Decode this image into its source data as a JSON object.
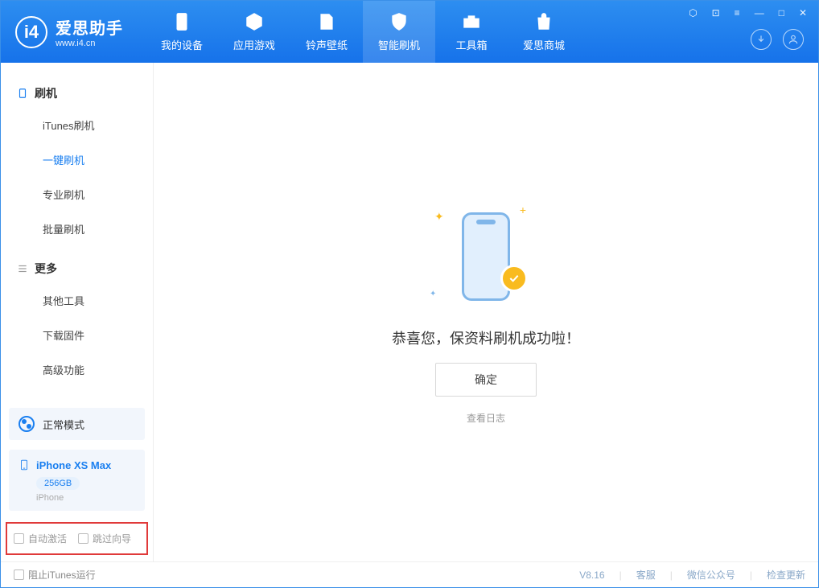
{
  "app": {
    "name": "爱思助手",
    "url": "www.i4.cn"
  },
  "nav": {
    "tabs": [
      "我的设备",
      "应用游戏",
      "铃声壁纸",
      "智能刷机",
      "工具箱",
      "爱思商城"
    ]
  },
  "sidebar": {
    "group1": {
      "title": "刷机",
      "items": [
        "iTunes刷机",
        "一键刷机",
        "专业刷机",
        "批量刷机"
      ]
    },
    "group2": {
      "title": "更多",
      "items": [
        "其他工具",
        "下载固件",
        "高级功能"
      ]
    }
  },
  "mode": {
    "label": "正常模式"
  },
  "device": {
    "name": "iPhone XS Max",
    "capacity": "256GB",
    "type": "iPhone"
  },
  "options": {
    "auto_activate": "自动激活",
    "skip_guide": "跳过向导"
  },
  "main": {
    "success": "恭喜您，保资料刷机成功啦！",
    "confirm": "确定",
    "view_log": "查看日志"
  },
  "footer": {
    "block_itunes": "阻止iTunes运行",
    "version": "V8.16",
    "links": [
      "客服",
      "微信公众号",
      "检查更新"
    ]
  }
}
